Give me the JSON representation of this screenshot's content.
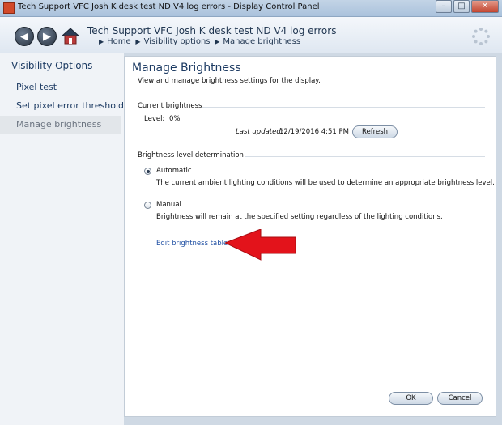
{
  "window": {
    "title": "Tech Support VFC Josh K desk test ND V4 log errors - Display Control Panel",
    "controls": {
      "minimize": "–",
      "maximize": "□",
      "close": "✕"
    }
  },
  "navbar": {
    "title": "Tech Support VFC Josh K desk test ND V4 log errors",
    "breadcrumb": [
      "Home",
      "Visibility options",
      "Manage brightness"
    ],
    "back_icon": "◀",
    "forward_icon": "▶"
  },
  "sidebar": {
    "heading": "Visibility Options",
    "items": [
      {
        "label": "Pixel test"
      },
      {
        "label": "Set pixel error threshold"
      },
      {
        "label": "Manage brightness"
      }
    ]
  },
  "main": {
    "title": "Manage Brightness",
    "subtitle": "View and manage brightness settings for the display.",
    "current": {
      "section_label": "Current brightness",
      "level_label": "Level:",
      "level_value": "0%",
      "last_updated_label": "Last updated:",
      "last_updated_value": "12/19/2016 4:51 PM",
      "refresh_label": "Refresh"
    },
    "determination": {
      "section_label": "Brightness level determination",
      "automatic_label": "Automatic",
      "automatic_desc": "The current ambient lighting conditions will be used to determine an appropriate brightness level.",
      "manual_label": "Manual",
      "manual_desc": "Brightness will remain at the specified setting regardless of the lighting conditions.",
      "selected": "Automatic"
    },
    "edit_link": "Edit brightness table",
    "ok_label": "OK",
    "cancel_label": "Cancel"
  },
  "colors": {
    "accent_text": "#1d3b63",
    "link": "#1f4fa3",
    "annotation_arrow": "#e3131b"
  }
}
